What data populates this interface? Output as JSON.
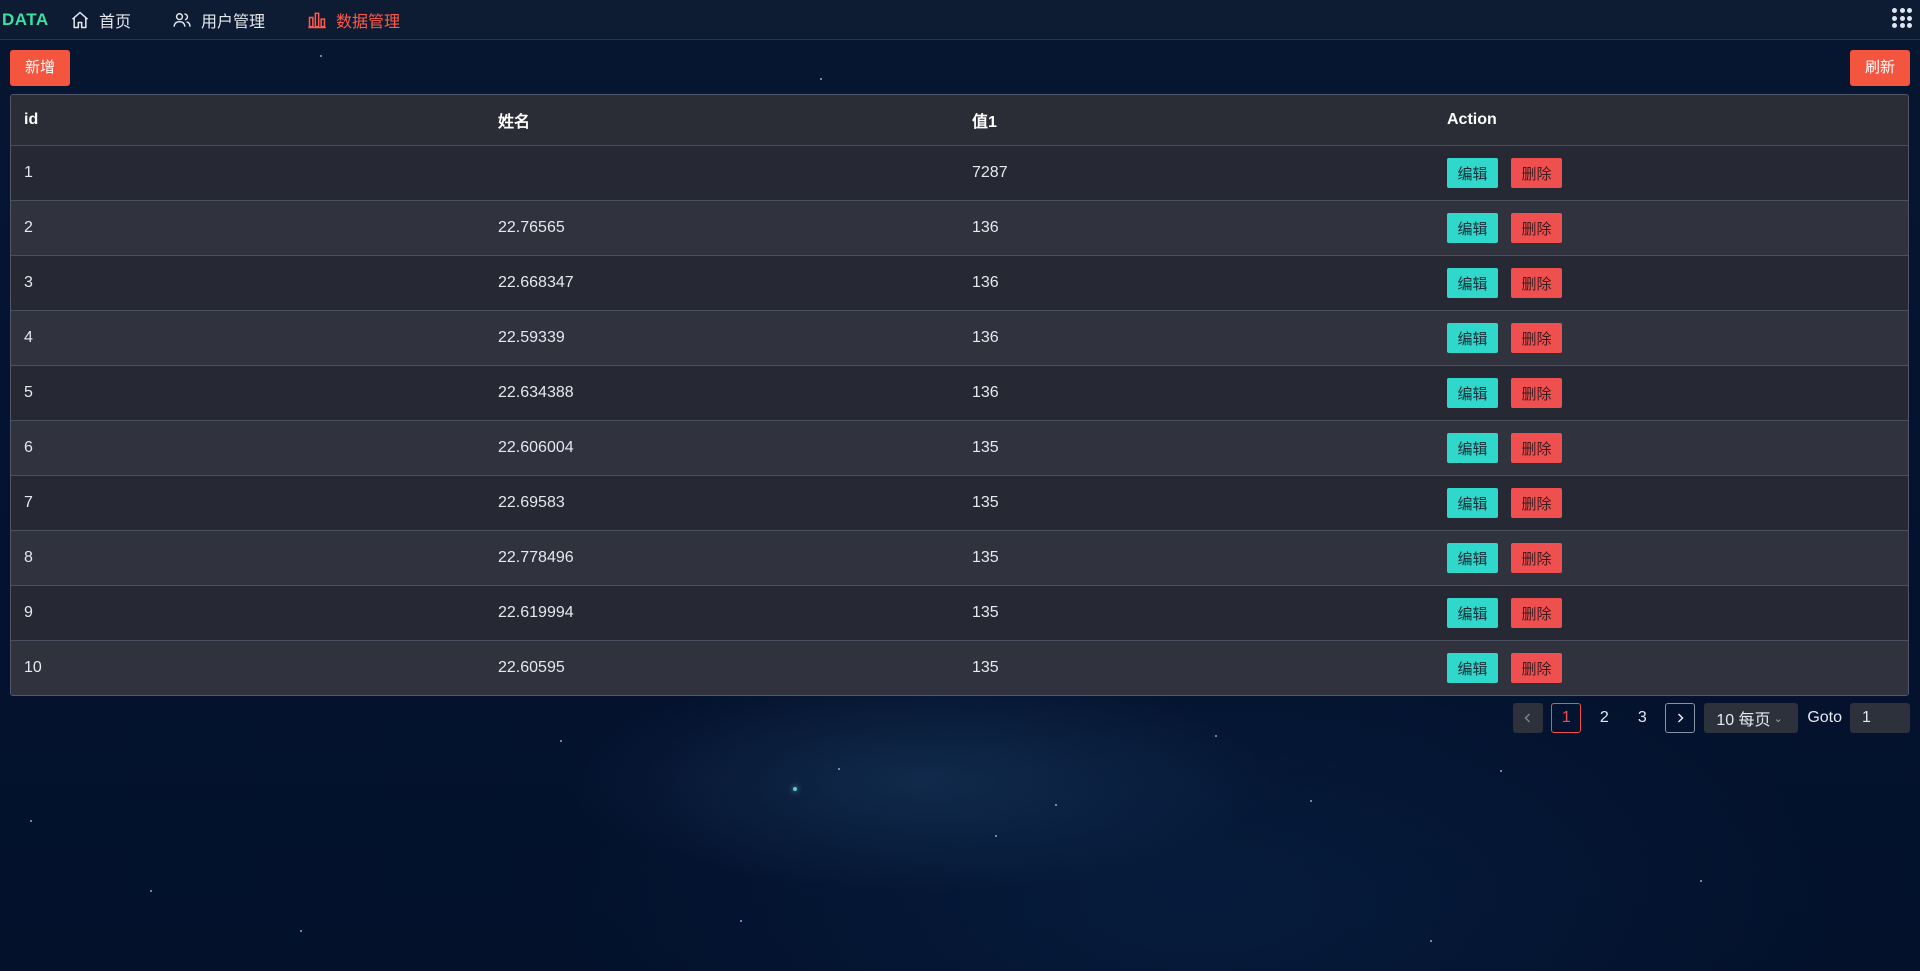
{
  "nav": {
    "logo": "DATA",
    "items": [
      {
        "label": "首页",
        "icon": "home-icon"
      },
      {
        "label": "用户管理",
        "icon": "users-icon"
      },
      {
        "label": "数据管理",
        "icon": "bar-chart-icon",
        "active": true
      }
    ],
    "apps_icon": "grid-menu-icon"
  },
  "toolbar": {
    "add_label": "新增",
    "refresh_label": "刷新"
  },
  "table": {
    "columns": [
      "id",
      "姓名",
      "值1",
      "Action"
    ],
    "edit_label": "编辑",
    "delete_label": "删除",
    "rows": [
      {
        "id": "1",
        "name": "",
        "value": "7287"
      },
      {
        "id": "2",
        "name": "22.76565",
        "value": "136"
      },
      {
        "id": "3",
        "name": "22.668347",
        "value": "136"
      },
      {
        "id": "4",
        "name": "22.59339",
        "value": "136"
      },
      {
        "id": "5",
        "name": "22.634388",
        "value": "136"
      },
      {
        "id": "6",
        "name": "22.606004",
        "value": "135"
      },
      {
        "id": "7",
        "name": "22.69583",
        "value": "135"
      },
      {
        "id": "8",
        "name": "22.778496",
        "value": "135"
      },
      {
        "id": "9",
        "name": "22.619994",
        "value": "135"
      },
      {
        "id": "10",
        "name": "22.60595",
        "value": "135"
      }
    ]
  },
  "pagination": {
    "pages": [
      "1",
      "2",
      "3"
    ],
    "current": "1",
    "page_size": "10 每页",
    "goto_label": "Goto",
    "goto_value": "1"
  },
  "colors": {
    "accent": "#f4553f",
    "edit": "#2fd8cb",
    "delete": "#f04f4f",
    "logo": "#3ee0a0"
  }
}
